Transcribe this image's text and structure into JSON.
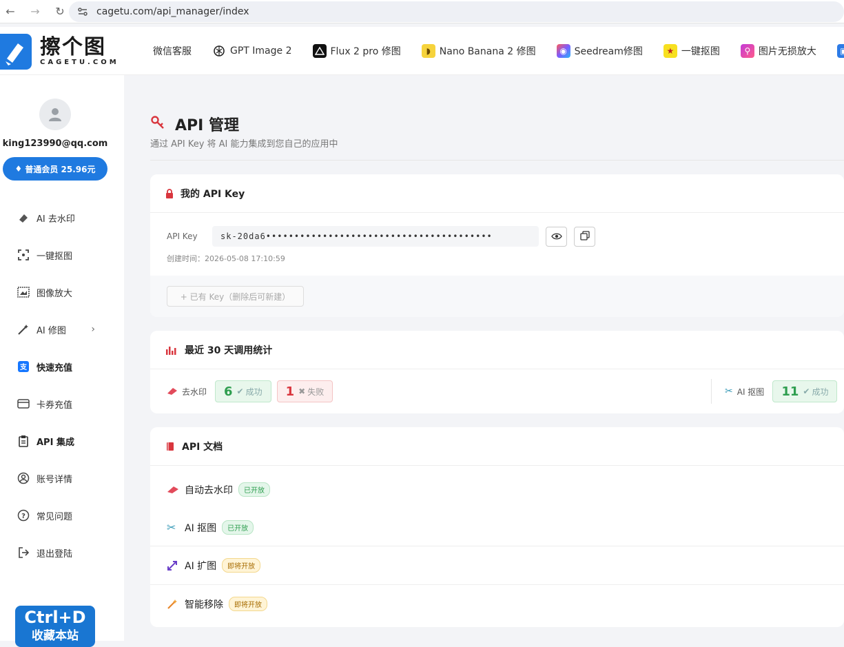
{
  "browser": {
    "url": "cagetu.com/api_manager/index"
  },
  "logo": {
    "cn": "擦个图",
    "en": "CAGETU.COM"
  },
  "topnav": [
    {
      "label": "微信客服",
      "icon": "none"
    },
    {
      "label": "GPT Image 2",
      "icon": "openai-icon"
    },
    {
      "label": "Flux 2 pro 修图",
      "icon": "flux-icon"
    },
    {
      "label": "Nano Banana 2 修图",
      "icon": "banana-icon"
    },
    {
      "label": "Seedream修图",
      "icon": "seedream-icon"
    },
    {
      "label": "一键抠图",
      "icon": "star-icon"
    },
    {
      "label": "图片无损放大",
      "icon": "magnify-icon"
    }
  ],
  "user": {
    "email": "king123990@qq.com",
    "member": "普通会员 25.96元"
  },
  "menu": [
    {
      "label": "AI 去水印",
      "icon": "eraser-icon"
    },
    {
      "label": "一键抠图",
      "icon": "crop-icon"
    },
    {
      "label": "图像放大",
      "icon": "image-enlarge-icon"
    },
    {
      "label": "AI 修图",
      "icon": "magic-wand-icon"
    },
    {
      "label": "快速充值",
      "icon": "alipay-icon"
    },
    {
      "label": "卡券充值",
      "icon": "card-icon"
    },
    {
      "label": "API 集成",
      "icon": "clipboard-icon"
    },
    {
      "label": "账号详情",
      "icon": "user-circle-icon"
    },
    {
      "label": "常见问题",
      "icon": "question-icon"
    },
    {
      "label": "退出登陆",
      "icon": "logout-icon"
    }
  ],
  "ctrld": {
    "line1": "Ctrl+D",
    "line2": "收藏本站"
  },
  "page": {
    "title": "API 管理",
    "subtitle": "通过 API Key 将 AI 能力集成到您自己的应用中"
  },
  "apikey": {
    "card_title": "我的 API Key",
    "label": "API Key",
    "value": "sk-20da6••••••••••••••••••••••••••••••••••••••••",
    "created": "创建时间：2026-05-08 17:10:59",
    "add_button": "+ 已有 Key（删除后可新建）"
  },
  "stats": {
    "card_title": "最近 30 天调用统计",
    "groups": [
      {
        "label": "去水印",
        "success": "6",
        "success_label": "成功",
        "fail": "1",
        "fail_label": "失败"
      },
      {
        "label": "AI 抠图",
        "success": "11",
        "success_label": "成功"
      }
    ]
  },
  "docs": {
    "card_title": "API 文档",
    "items": [
      {
        "label": "自动去水印",
        "tag": "已开放"
      },
      {
        "label": "AI 抠图",
        "tag": "已开放"
      },
      {
        "label": "AI 扩图",
        "tag": "即将开放"
      },
      {
        "label": "智能移除",
        "tag": "即将开放"
      }
    ]
  },
  "colors": {
    "accent": "#1f7ae0",
    "danger": "#d9363e",
    "success": "#2e9e4f"
  }
}
